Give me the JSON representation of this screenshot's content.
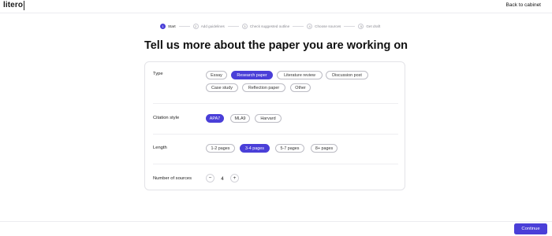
{
  "header": {
    "logo": "litero",
    "back_link": "Back to cabinet"
  },
  "stepper": {
    "steps": [
      {
        "num": "1",
        "label": "Start"
      },
      {
        "num": "2",
        "label": "Add guidelines"
      },
      {
        "num": "3",
        "label": "Check suggested outline"
      },
      {
        "num": "4",
        "label": "Choose sources"
      },
      {
        "num": "5",
        "label": "Get draft"
      }
    ],
    "active_step": 1
  },
  "headline": "Tell us more about the paper you are working on",
  "form": {
    "type": {
      "label": "Type",
      "options": [
        "Essay",
        "Research paper",
        "Literature review",
        "Discussion post",
        "Case study",
        "Reflection paper",
        "Other"
      ],
      "selected": "Research paper"
    },
    "citation": {
      "label": "Citation style",
      "options": [
        "APA7",
        "MLA9",
        "Harvard"
      ],
      "selected": "APA7"
    },
    "length": {
      "label": "Length",
      "options": [
        "1-2 pages",
        "3-4 pages",
        "5-7 pages",
        "8+ pages"
      ],
      "selected": "3-4 pages"
    },
    "sources": {
      "label": "Number of sources",
      "decrement": "−",
      "value": "4",
      "increment": "+"
    }
  },
  "footer": {
    "continue_label": "Continue"
  },
  "colors": {
    "accent": "#4a3fd8"
  }
}
